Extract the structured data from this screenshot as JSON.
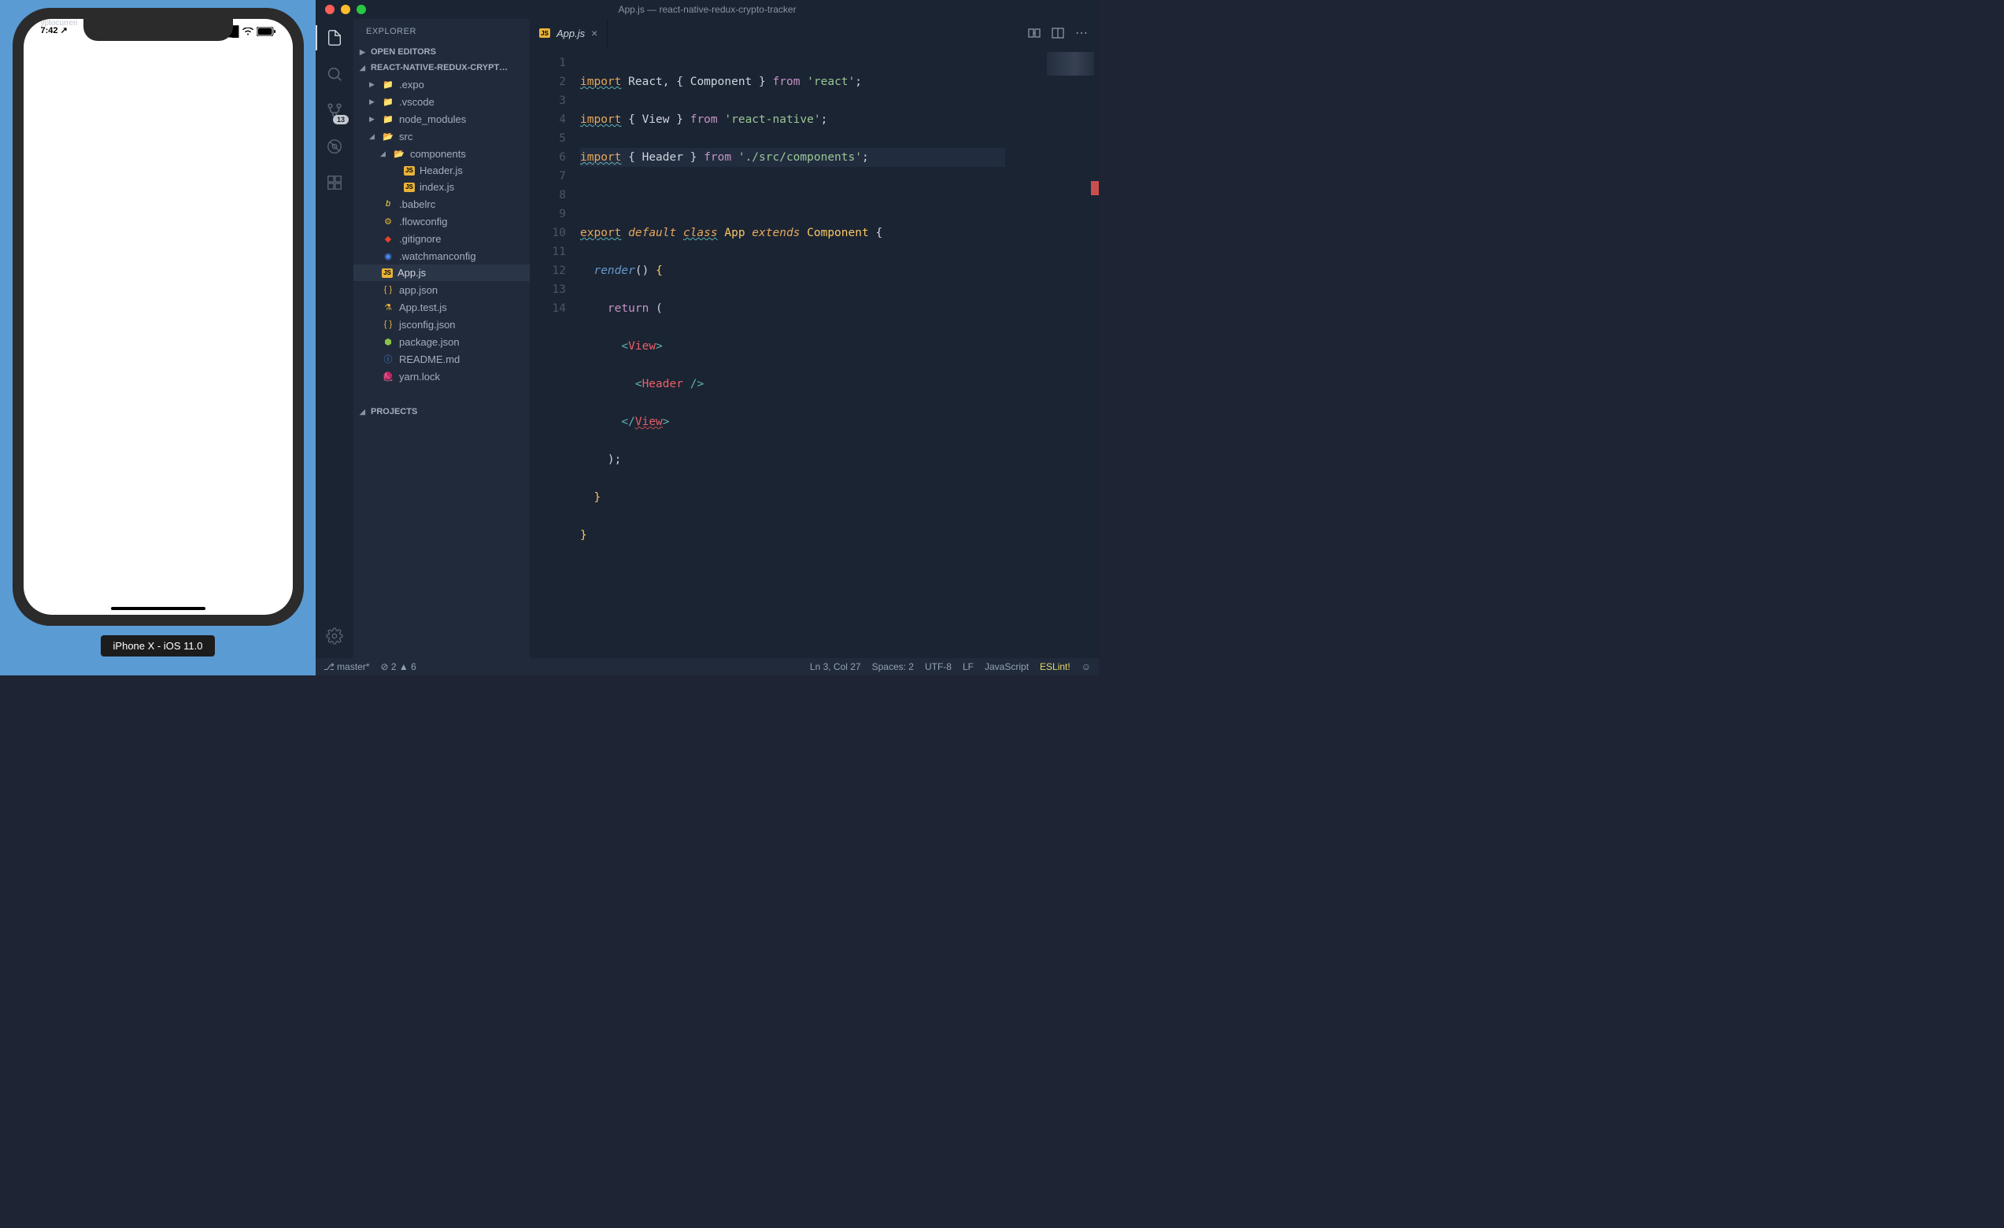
{
  "simulator": {
    "app_title": "yptocurren",
    "time": "7:42",
    "device_label": "iPhone X - iOS 11.0"
  },
  "titlebar": {
    "title": "App.js — react-native-redux-crypto-tracker"
  },
  "activity_bar": {
    "scm_badge": "13"
  },
  "sidebar": {
    "title": "EXPLORER",
    "sections": {
      "open_editors": "OPEN EDITORS",
      "project": "REACT-NATIVE-REDUX-CRYPT…",
      "projects": "PROJECTS"
    },
    "files": {
      "expo": ".expo",
      "vscode": ".vscode",
      "node_modules": "node_modules",
      "src": "src",
      "components": "components",
      "header_js": "Header.js",
      "index_js": "index.js",
      "babelrc": ".babelrc",
      "flowconfig": ".flowconfig",
      "gitignore": ".gitignore",
      "watchmanconfig": ".watchmanconfig",
      "app_js": "App.js",
      "app_json": "app.json",
      "app_test_js": "App.test.js",
      "jsconfig_json": "jsconfig.json",
      "package_json": "package.json",
      "readme_md": "README.md",
      "yarn_lock": "yarn.lock"
    }
  },
  "tabs": {
    "active": "App.js"
  },
  "editor": {
    "line_numbers": [
      "1",
      "2",
      "3",
      "4",
      "5",
      "6",
      "7",
      "8",
      "9",
      "10",
      "11",
      "12",
      "13",
      "14"
    ],
    "code": {
      "l1": {
        "import": "import",
        "react": "React",
        "comma": ",",
        "lb": "{",
        "component": "Component",
        "rb": "}",
        "from": "from",
        "str": "'react'",
        "semi": ";"
      },
      "l2": {
        "import": "import",
        "lb": "{",
        "view": "View",
        "rb": "}",
        "from": "from",
        "str": "'react-native'",
        "semi": ";"
      },
      "l3": {
        "import": "import",
        "lb": "{",
        "header": "Header",
        "rb": "}",
        "from": "from",
        "str": "'./src/components'",
        "semi": ";"
      },
      "l5": {
        "export": "export",
        "default": "default",
        "class": "class",
        "app": "App",
        "extends": "extends",
        "component": "Component",
        "lb": "{"
      },
      "l6": {
        "render": "render",
        "paren": "()",
        "lb": "{"
      },
      "l7": {
        "return": "return",
        "lp": "("
      },
      "l8": {
        "lt": "<",
        "view": "View",
        "gt": ">"
      },
      "l9": {
        "lt": "<",
        "header": "Header",
        "slash": " /",
        "gt": ">"
      },
      "l10": {
        "lt": "</",
        "view": "View",
        "gt": ">"
      },
      "l11": {
        "rp": ")",
        "semi": ";"
      },
      "l12": {
        "rb": "}"
      },
      "l13": {
        "rb": "}"
      }
    }
  },
  "statusbar": {
    "branch": "master*",
    "errors": "2",
    "warnings": "6",
    "ln_col": "Ln 3, Col 27",
    "spaces": "Spaces: 2",
    "encoding": "UTF-8",
    "eol": "LF",
    "lang": "JavaScript",
    "eslint": "ESLint!"
  }
}
